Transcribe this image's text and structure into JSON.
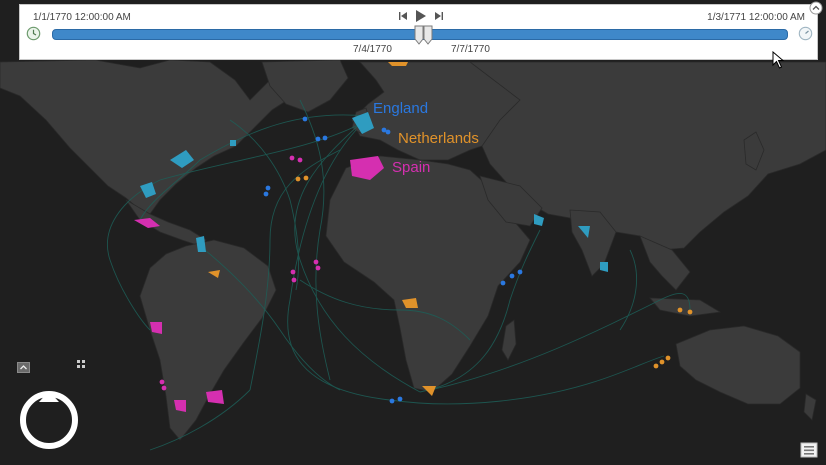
{
  "timeline": {
    "start_label": "1/1/1770 12:00:00 AM",
    "end_label": "1/3/1771 12:00:00 AM",
    "marker_a_label": "7/4/1770",
    "marker_b_label": "7/7/1770",
    "accent_color": "#3f88c9"
  },
  "legend": {
    "england": {
      "label": "England",
      "color": "#2a78e0"
    },
    "netherlands": {
      "label": "Netherlands",
      "color": "#e0922a"
    },
    "spain": {
      "label": "Spain",
      "color": "#d52fb0"
    }
  },
  "icons": {
    "clock": "clock-icon",
    "speed": "speed-dial-icon",
    "skip_back": "skip-back-icon",
    "play": "play-icon",
    "skip_forward": "skip-forward-icon",
    "collapse": "chevron-up-icon",
    "compass": "compass-icon",
    "layers": "layers-icon"
  },
  "map": {
    "ocean_color": "#1f1f1f",
    "land_color": "#3b3b3b",
    "route_color": "#1d5f58"
  }
}
